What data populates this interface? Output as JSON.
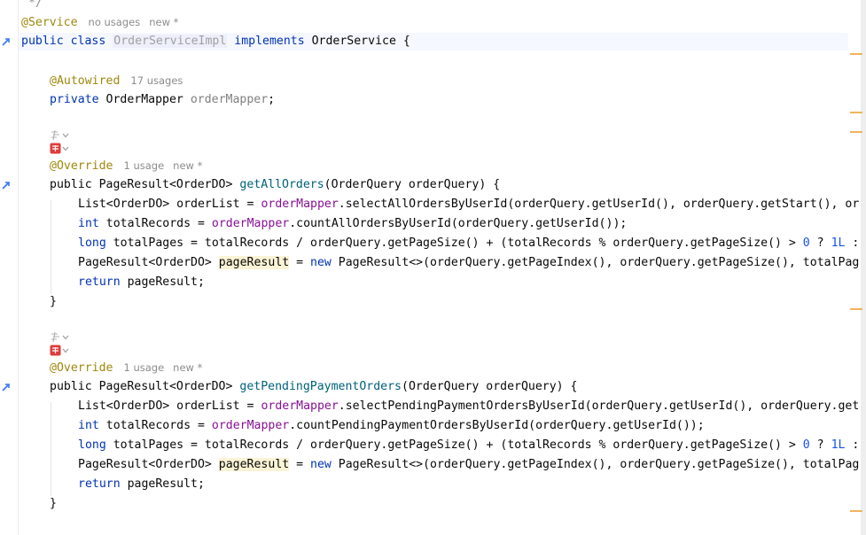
{
  "editor": {
    "top_comment": "*/",
    "class_annotation": "@Service",
    "class_annotation_usages": "no usages",
    "class_annotation_new": "new *",
    "class_decl": {
      "kw_public": "public",
      "kw_class": "class",
      "name": "OrderServiceImpl",
      "kw_implements": "implements",
      "iface": "OrderService",
      "brace": "{"
    },
    "field_annotation": "@Autowired",
    "field_annotation_usages": "17 usages",
    "field_decl": {
      "kw": "private",
      "type": "OrderMapper",
      "name": "orderMapper",
      "semi": ";"
    },
    "method1": {
      "annotation": "@Override",
      "usages": "1 usage",
      "new": "new *",
      "sig_prefix": "public PageResult<OrderDO> ",
      "name": "getAllOrders",
      "params": "(OrderQuery orderQuery) {",
      "l1_a": "List<OrderDO> orderList = ",
      "l1_field": "orderMapper",
      "l1_b": ".selectAllOrdersByUserId(orderQuery.getUserId(), orderQuery.getStart(), or",
      "l2_kw": "int",
      "l2_a": " totalRecords = ",
      "l2_field": "orderMapper",
      "l2_b": ".countAllOrdersByUserId(orderQuery.getUserId());",
      "l3_kw": "long",
      "l3_a": " totalPages = totalRecords / orderQuery.getPageSize() + (totalRecords % orderQuery.getPageSize() > ",
      "l3_n0": "0",
      "l3_q": " ? ",
      "l3_n1": "1L",
      "l3_tail": " :",
      "l4_a": "PageResult<OrderDO> ",
      "l4_var": "pageResult",
      "l4_eq": " = ",
      "l4_kw": "new",
      "l4_b": " PageResult<>(orderQuery.getPageIndex(), orderQuery.getPageSize(), totalPag",
      "l5_kw": "return",
      "l5_b": " pageResult;",
      "close": "}"
    },
    "method2": {
      "annotation": "@Override",
      "usages": "1 usage",
      "new": "new *",
      "sig_prefix": "public PageResult<OrderDO> ",
      "name": "getPendingPaymentOrders",
      "params": "(OrderQuery orderQuery) {",
      "l1_a": "List<OrderDO> orderList = ",
      "l1_field": "orderMapper",
      "l1_b": ".selectPendingPaymentOrdersByUserId(orderQuery.getUserId(), orderQuery.get",
      "l2_kw": "int",
      "l2_a": " totalRecords = ",
      "l2_field": "orderMapper",
      "l2_b": ".countPendingPaymentOrdersByUserId(orderQuery.getUserId());",
      "l3_kw": "long",
      "l3_a": " totalPages = totalRecords / orderQuery.getPageSize() + (totalRecords % orderQuery.getPageSize() > ",
      "l3_n0": "0",
      "l3_q": " ? ",
      "l3_n1": "1L",
      "l3_tail": " :",
      "l4_a": "PageResult<OrderDO> ",
      "l4_var": "pageResult",
      "l4_eq": " = ",
      "l4_kw": "new",
      "l4_b": " PageResult<>(orderQuery.getPageIndex(), orderQuery.getPageSize(), totalPag",
      "l5_kw": "return",
      "l5_b": " pageResult;",
      "close": "}"
    }
  },
  "icons": {
    "implements_gutter": "implementing-method-icon",
    "ai_assistant": "ai-assistant-icon",
    "plugin_badge": "plugin-badge-icon"
  },
  "colors": {
    "keyword": "#0033b3",
    "annotation": "#9e880d",
    "field": "#871094",
    "method_decl": "#00627a",
    "number": "#1750eb",
    "hint": "#8c8c8c"
  }
}
